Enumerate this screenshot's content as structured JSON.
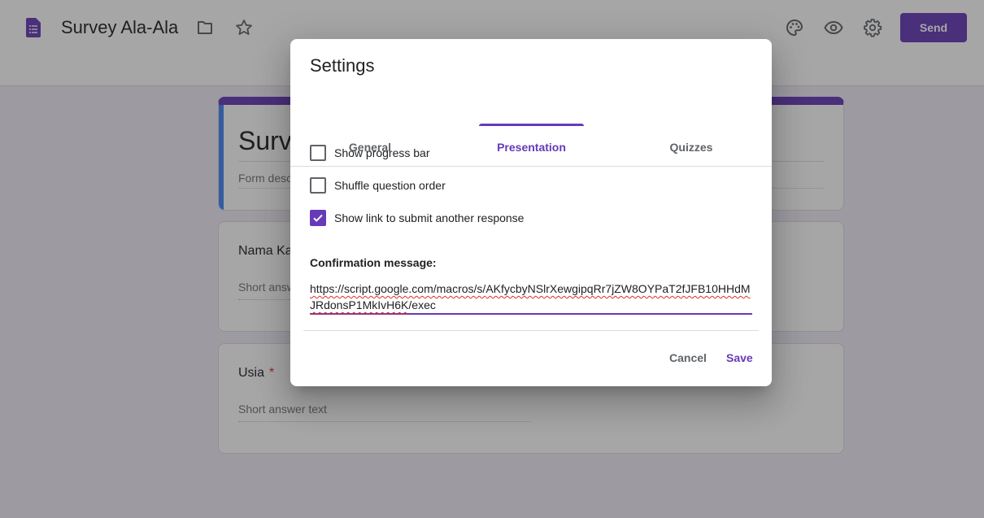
{
  "header": {
    "doc_title": "Survey Ala-Ala",
    "send_label": "Send",
    "icons": [
      "forms-logo-icon",
      "folder-icon",
      "star-icon",
      "palette-icon",
      "preview-eye-icon",
      "settings-gear-icon"
    ],
    "accent_color": "#673ab7"
  },
  "form": {
    "title": "Survey Ala-Ala",
    "description_placeholder": "Form description",
    "questions": [
      {
        "title": "Nama Kamu",
        "required": false,
        "placeholder": "Short answer text"
      },
      {
        "title": "Usia",
        "required": true,
        "required_mark": "*",
        "placeholder": "Short answer text"
      }
    ]
  },
  "dialog": {
    "title": "Settings",
    "tabs": [
      {
        "label": "General",
        "active": false
      },
      {
        "label": "Presentation",
        "active": true
      },
      {
        "label": "Quizzes",
        "active": false
      }
    ],
    "options": [
      {
        "label": "Show progress bar",
        "checked": false
      },
      {
        "label": "Shuffle question order",
        "checked": false
      },
      {
        "label": "Show link to submit another response",
        "checked": true
      }
    ],
    "confirmation_label": "Confirmation message:",
    "confirmation_url_start": "https://script.google.com/macros/s/",
    "confirmation_url_id": "AKfycbyNSlrXewgipqRr7jZW8OYPaT2fJFB10HHdMJRdonsP1MkIvH6K",
    "confirmation_url_end": "/exec",
    "cancel_label": "Cancel",
    "save_label": "Save"
  }
}
